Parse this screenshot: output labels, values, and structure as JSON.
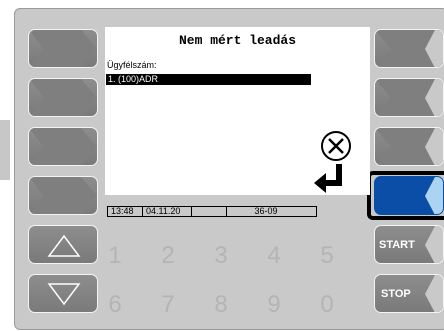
{
  "screen": {
    "title": "Nem mért leadás",
    "field_label": "Ügyfélszám:",
    "selected_item": "1.  (100)ADR",
    "status": {
      "time": "13:48",
      "date": "04.11.20",
      "blank": "",
      "code": "36-09"
    }
  },
  "keypad": {
    "row1": [
      "1",
      "2",
      "3",
      "4",
      "5"
    ],
    "row2": [
      "6",
      "7",
      "8",
      "9",
      "0"
    ]
  },
  "right_buttons": {
    "start_label": "START",
    "stop_label": "STOP"
  },
  "icons": {
    "cancel": "cancel-x-icon",
    "enter": "enter-icon",
    "up": "arrow-up-icon",
    "down": "arrow-down-icon"
  },
  "colors": {
    "active_key": "#0a4ea8",
    "active_arrow": "#aad4f2",
    "button_gray": "#828282"
  }
}
